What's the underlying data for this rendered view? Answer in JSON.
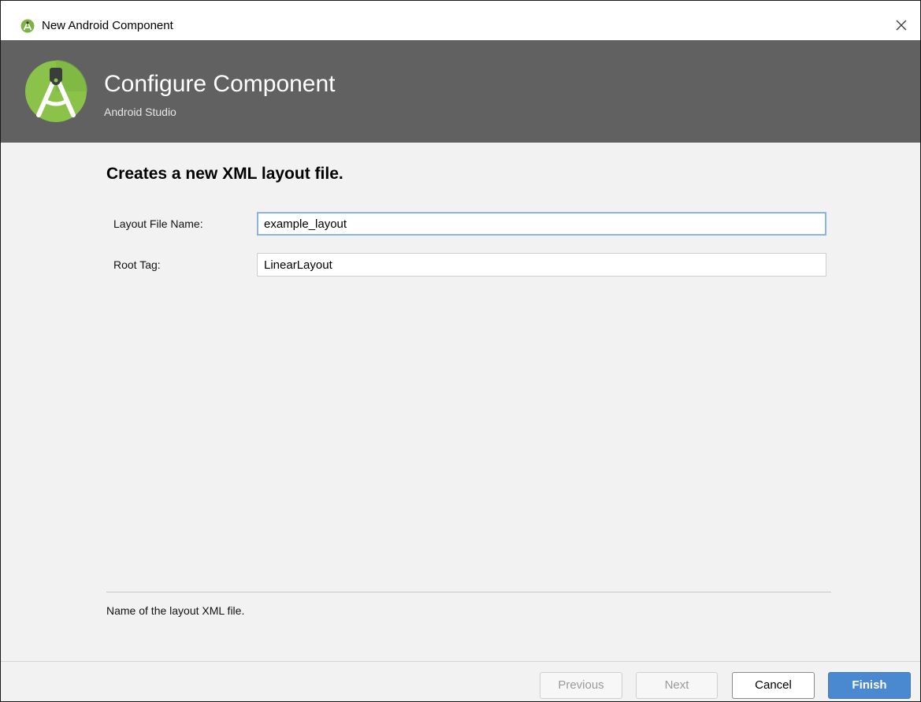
{
  "window": {
    "title": "New Android Component",
    "close_icon": "close-icon",
    "app_icon": "android-studio-icon"
  },
  "banner": {
    "heading": "Configure Component",
    "subheading": "Android Studio",
    "logo_icon": "android-studio-logo",
    "background_color": "#616161"
  },
  "content": {
    "title": "Creates a new XML layout file.",
    "fields": [
      {
        "label": "Layout File Name:",
        "value": "example_layout",
        "focused": true
      },
      {
        "label": "Root Tag:",
        "value": "LinearLayout",
        "focused": false
      }
    ],
    "hint": "Name of the layout XML file."
  },
  "buttons": {
    "previous": {
      "label": "Previous",
      "enabled": false
    },
    "next": {
      "label": "Next",
      "enabled": false
    },
    "cancel": {
      "label": "Cancel",
      "enabled": true
    },
    "finish": {
      "label": "Finish",
      "enabled": true,
      "color": "#4a88d0"
    }
  }
}
